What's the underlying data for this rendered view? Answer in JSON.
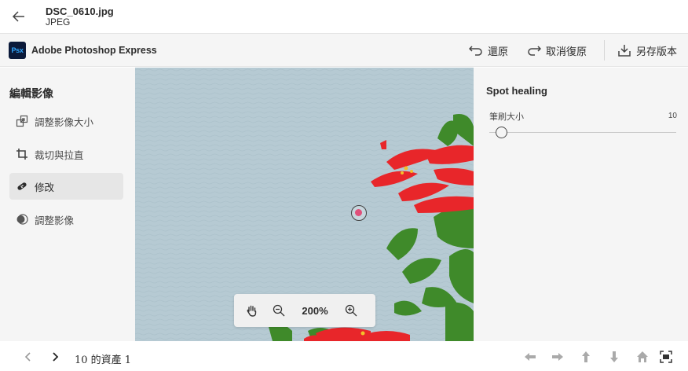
{
  "file": {
    "name": "DSC_0610.jpg",
    "type": "JPEG"
  },
  "app": {
    "logo_text": "Psx",
    "name": "Adobe Photoshop Express",
    "actions": {
      "undo": "還原",
      "redo": "取消復原",
      "save_version": "另存版本"
    }
  },
  "left_panel": {
    "title": "編輯影像",
    "items": [
      {
        "label": "調整影像大小",
        "icon": "resize-icon",
        "active": false
      },
      {
        "label": "裁切與拉直",
        "icon": "crop-icon",
        "active": false
      },
      {
        "label": "修改",
        "icon": "bandage-icon",
        "active": true
      },
      {
        "label": "調整影像",
        "icon": "adjust-icon",
        "active": false
      }
    ]
  },
  "zoom": {
    "level": "200%"
  },
  "right_panel": {
    "title": "Spot healing",
    "brush_label": "筆刷大小",
    "brush_value": "10"
  },
  "pager": {
    "text": "10 的資產 1"
  },
  "colors": {
    "accent": "#31a8ff",
    "logo_bg": "#0b1a3a",
    "panel_bg": "#f5f5f5",
    "water": "#b5c9d2",
    "flower_red": "#e8262a",
    "leaf_green": "#3f8a2a"
  }
}
